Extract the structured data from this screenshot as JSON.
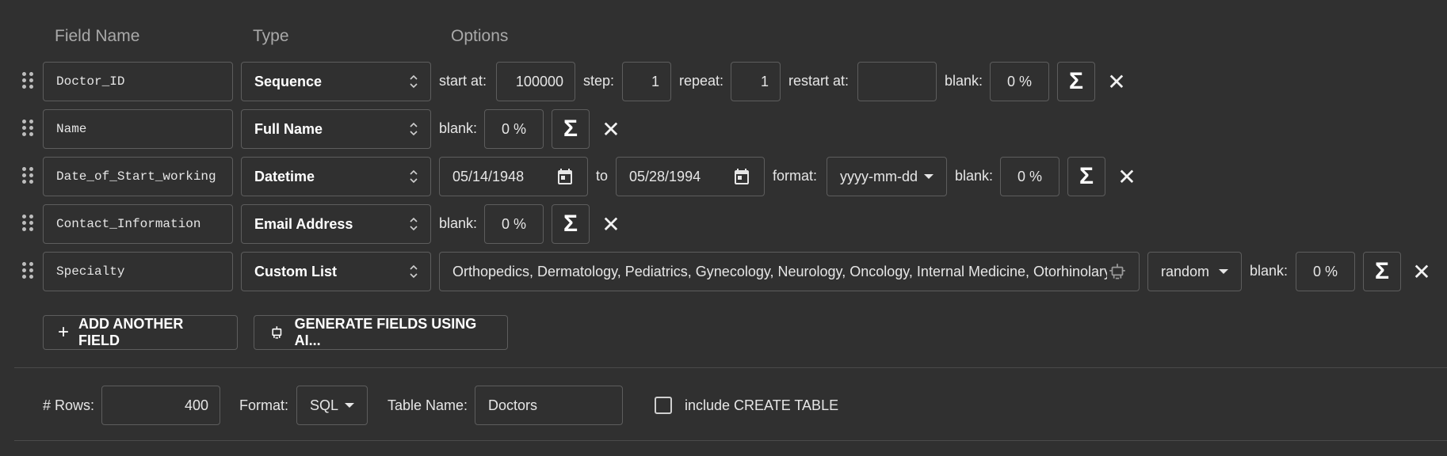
{
  "headers": {
    "field_name": "Field Name",
    "type": "Type",
    "options": "Options"
  },
  "rows": [
    {
      "name": "Doctor_ID",
      "type": "Sequence",
      "opts": {
        "start_label": "start at:",
        "start": "100000",
        "step_label": "step:",
        "step": "1",
        "repeat_label": "repeat:",
        "repeat": "1",
        "restart_label": "restart at:",
        "restart": "",
        "blank_label": "blank:",
        "blank": "0 %"
      }
    },
    {
      "name": "Name",
      "type": "Full Name",
      "opts": {
        "blank_label": "blank:",
        "blank": "0 %"
      }
    },
    {
      "name": "Date_of_Start_working",
      "type": "Datetime",
      "opts": {
        "from": "05/14/1948",
        "to_label": "to",
        "to": "05/28/1994",
        "format_label": "format:",
        "format": "yyyy-mm-dd",
        "blank_label": "blank:",
        "blank": "0 %"
      }
    },
    {
      "name": "Contact_Information",
      "type": "Email Address",
      "opts": {
        "blank_label": "blank:",
        "blank": "0 %"
      }
    },
    {
      "name": "Specialty",
      "type": "Custom List",
      "opts": {
        "values": "Orthopedics, Dermatology, Pediatrics, Gynecology, Neurology, Oncology, Internal Medicine, Otorhinolaryngology",
        "order": "random",
        "blank_label": "blank:",
        "blank": "0 %"
      }
    }
  ],
  "buttons": {
    "add_field": "ADD ANOTHER FIELD",
    "generate_ai": "GENERATE FIELDS USING AI..."
  },
  "footer": {
    "rows_label": "# Rows:",
    "rows": "400",
    "format_label": "Format:",
    "format": "SQL",
    "table_label": "Table Name:",
    "table": "Doctors",
    "create_table_label": "include CREATE TABLE",
    "create_table_checked": false
  },
  "icons": {
    "drag": "drag-handle-icon",
    "sigma": "sigma-icon",
    "close": "close-icon",
    "calendar": "calendar-icon",
    "robot": "robot-icon",
    "plus": "plus-icon",
    "select_arrows": "unfold-icon",
    "caret": "caret-down-icon"
  }
}
